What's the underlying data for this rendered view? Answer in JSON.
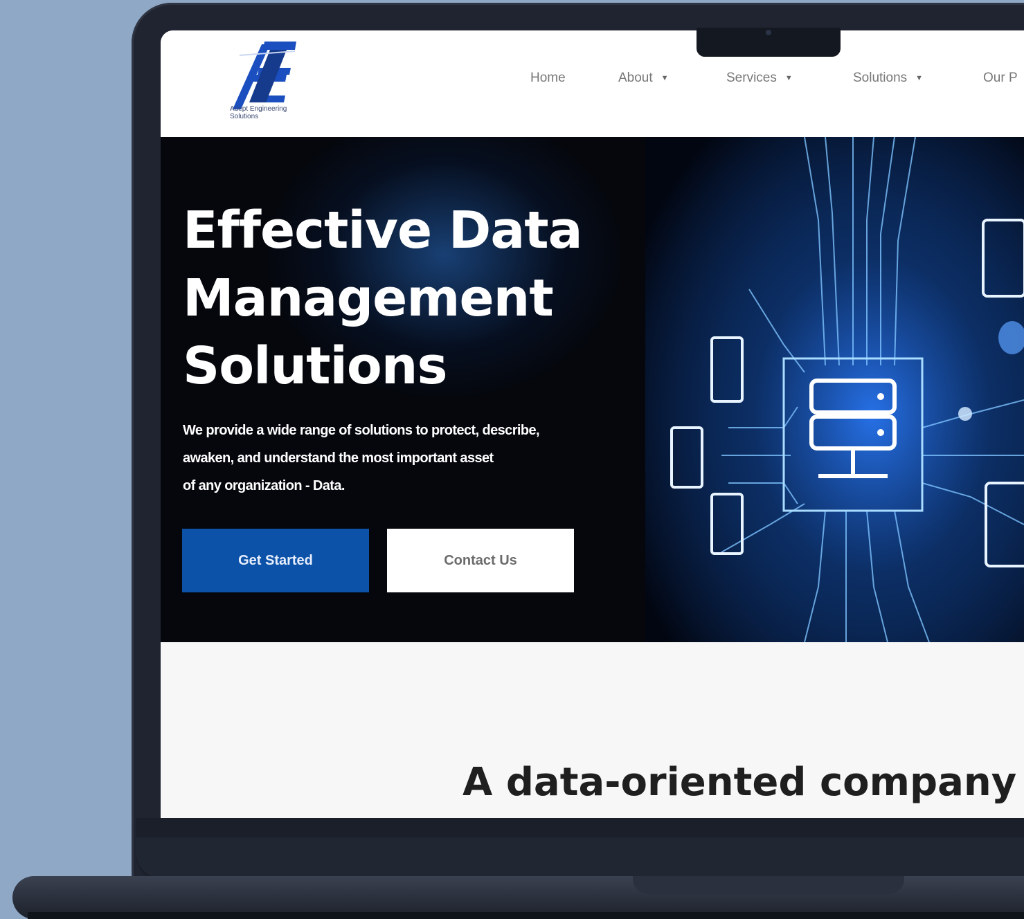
{
  "brand": {
    "logo_name": "ae-logo",
    "tagline_line1": "Adept Engineering",
    "tagline_line2": "Solutions"
  },
  "nav": {
    "home": "Home",
    "about": "About",
    "services": "Services",
    "solutions": "Solutions",
    "our": "Our P"
  },
  "hero": {
    "title_line1": "Effective Data",
    "title_line2": "Management",
    "title_line3": "Solutions",
    "subtitle_line1": "We provide a wide range of solutions to protect, describe,",
    "subtitle_line2": "awaken, and understand the most important asset",
    "subtitle_line3": "of any organization - Data.",
    "primary_cta": "Get Started",
    "secondary_cta": "Contact Us"
  },
  "section": {
    "heading": "A data-oriented company th"
  },
  "colors": {
    "background": "#8fa8c6",
    "brand_blue": "#0b52a8",
    "hero_bg": "#05070d"
  }
}
